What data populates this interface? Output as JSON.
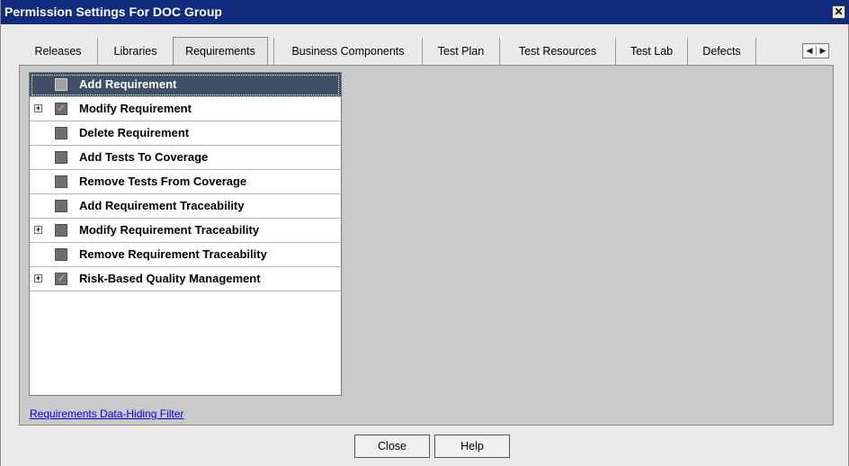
{
  "window": {
    "title": "Permission Settings For DOC Group",
    "close_glyph": "✕"
  },
  "tabs": [
    {
      "label": "Releases",
      "active": false
    },
    {
      "label": "Libraries",
      "active": false
    },
    {
      "label": "Requirements",
      "active": true
    },
    {
      "label": "Business Components",
      "active": false
    },
    {
      "label": "Test Plan",
      "active": false
    },
    {
      "label": "Test Resources",
      "active": false
    },
    {
      "label": "Test Lab",
      "active": false
    },
    {
      "label": "Defects",
      "active": false
    }
  ],
  "tab_scroll": {
    "left_glyph": "◀",
    "right_glyph": "▶"
  },
  "permissions": [
    {
      "label": "Add Requirement",
      "checked": false,
      "expandable": false,
      "selected": true
    },
    {
      "label": "Modify Requirement",
      "checked": true,
      "expandable": true,
      "selected": false
    },
    {
      "label": "Delete Requirement",
      "checked": false,
      "expandable": false,
      "selected": false
    },
    {
      "label": "Add Tests To Coverage",
      "checked": false,
      "expandable": false,
      "selected": false
    },
    {
      "label": "Remove Tests From Coverage",
      "checked": false,
      "expandable": false,
      "selected": false
    },
    {
      "label": "Add Requirement Traceability",
      "checked": false,
      "expandable": false,
      "selected": false
    },
    {
      "label": "Modify Requirement Traceability",
      "checked": false,
      "expandable": true,
      "selected": false
    },
    {
      "label": "Remove Requirement Traceability",
      "checked": false,
      "expandable": false,
      "selected": false
    },
    {
      "label": "Risk-Based Quality Management",
      "checked": true,
      "expandable": true,
      "selected": false
    }
  ],
  "expander_glyph": "+",
  "check_glyph": "✓",
  "filter_link": "Requirements Data-Hiding Filter",
  "buttons": {
    "close": "Close",
    "help": "Help"
  },
  "colors": {
    "titlebar": "#112c7e",
    "selected_row": "#3f4f66",
    "link": "#0000ee"
  }
}
